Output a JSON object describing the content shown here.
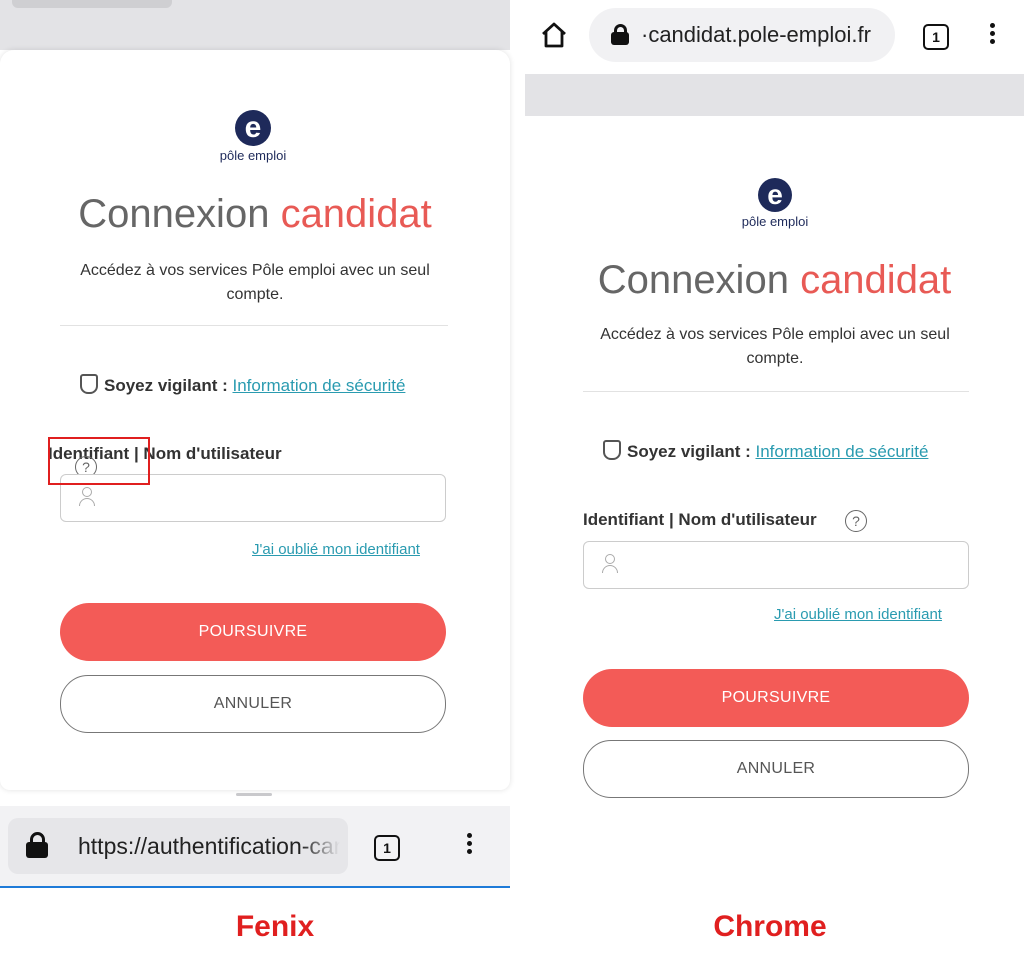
{
  "fenix": {
    "url": "https://authentification-candidat.pole-emploi.fr",
    "tab_count": "1",
    "caption": "Fenix"
  },
  "chrome": {
    "url": "·candidat.pole-emploi.fr",
    "tab_count": "1",
    "caption": "Chrome"
  },
  "page": {
    "logo_letter": "e",
    "logo_text": "pôle emploi",
    "title_main": "Connexion",
    "title_accent": "candidat",
    "subtitle_line1": "Accédez à vos services Pôle emploi avec un seul",
    "subtitle_line2": "compte.",
    "vigilant_bold": "Soyez vigilant :",
    "vigilant_link": "Information de sécurité",
    "identifier_label": "Identifiant | Nom d'utilisateur",
    "help_glyph": "?",
    "forgot_link": "J'ai oublié mon identifiant",
    "continue_button": "POURSUIVRE",
    "cancel_button": "ANNULER"
  },
  "colors": {
    "accent": "#e85a55",
    "primary_button": "#f35b57",
    "link": "#2a9bb0",
    "logo": "#1e2a5a",
    "highlight": "#e01f1f"
  },
  "icons": [
    "lock-icon",
    "tabs-icon",
    "menu-icon",
    "home-icon",
    "shield-icon",
    "help-icon",
    "user-icon"
  ]
}
